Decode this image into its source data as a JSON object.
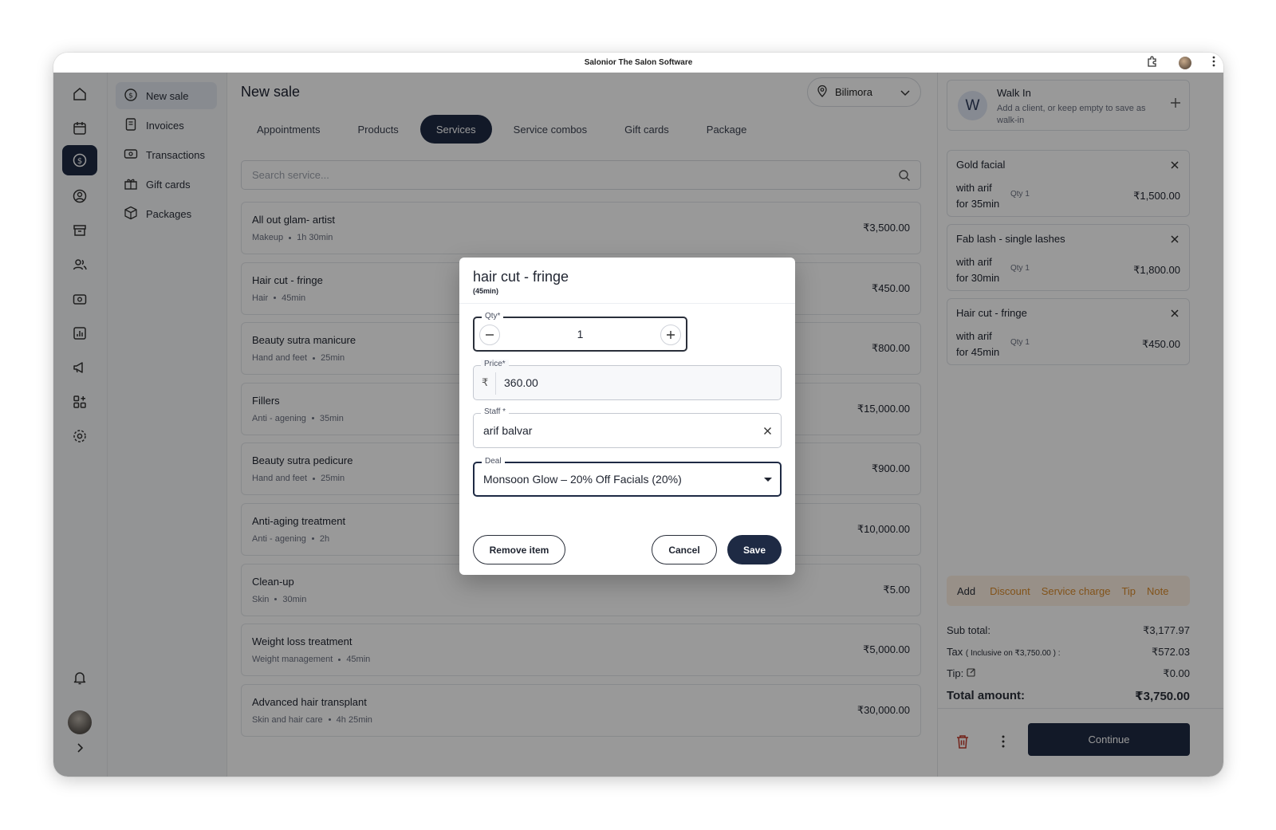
{
  "window": {
    "title": "Salonior The Salon Software"
  },
  "rail": {
    "icons": [
      "home-icon",
      "calendar-icon",
      "dollar-icon",
      "client-icon",
      "inventory-icon",
      "team-icon",
      "payments-icon",
      "reports-icon",
      "marketing-icon",
      "apps-icon",
      "settings-icon",
      "bell-icon",
      "avatar",
      "chevron-right-icon"
    ],
    "active": "dollar-icon"
  },
  "subnav": {
    "items": [
      {
        "label": "New sale",
        "icon": "dollar-plus-icon",
        "active": true
      },
      {
        "label": "Invoices",
        "icon": "invoice-icon",
        "active": false
      },
      {
        "label": "Transactions",
        "icon": "transaction-icon",
        "active": false
      },
      {
        "label": "Gift cards",
        "icon": "gift-icon",
        "active": false
      },
      {
        "label": "Packages",
        "icon": "package-icon",
        "active": false
      }
    ]
  },
  "main": {
    "title": "New sale",
    "location": "Bilimora",
    "tabs": [
      {
        "label": "Appointments",
        "active": false
      },
      {
        "label": "Products",
        "active": false
      },
      {
        "label": "Services",
        "active": true
      },
      {
        "label": "Service combos",
        "active": false
      },
      {
        "label": "Gift cards",
        "active": false
      },
      {
        "label": "Package",
        "active": false
      }
    ],
    "search_placeholder": "Search service...",
    "services": [
      {
        "name": "All out glam- artist",
        "category": "Makeup",
        "duration": "1h 30min",
        "price": "₹3,500.00"
      },
      {
        "name": "Hair cut - fringe",
        "category": "Hair",
        "duration": "45min",
        "price": "₹450.00"
      },
      {
        "name": "Beauty sutra manicure",
        "category": "Hand and feet",
        "duration": "25min",
        "price": "₹800.00"
      },
      {
        "name": "Fillers",
        "category": "Anti - agening",
        "duration": "35min",
        "price": "₹15,000.00"
      },
      {
        "name": "Beauty sutra pedicure",
        "category": "Hand and feet",
        "duration": "25min",
        "price": "₹900.00"
      },
      {
        "name": "Anti-aging treatment",
        "category": "Anti - agening",
        "duration": "2h",
        "price": "₹10,000.00"
      },
      {
        "name": "Clean-up",
        "category": "Skin",
        "duration": "30min",
        "price": "₹5.00"
      },
      {
        "name": "Weight loss treatment",
        "category": "Weight management",
        "duration": "45min",
        "price": "₹5,000.00"
      },
      {
        "name": "Advanced hair transplant",
        "category": "Skin and hair care",
        "duration": "4h 25min",
        "price": "₹30,000.00"
      }
    ]
  },
  "cart": {
    "client": {
      "initial": "W",
      "name": "Walk In",
      "desc": "Add a client, or keep empty to save as walk-in"
    },
    "items": [
      {
        "name": "Gold facial",
        "with": "with arif",
        "for": "for 35min",
        "qty": "Qty 1",
        "price": "₹1,500.00"
      },
      {
        "name": "Fab lash - single lashes",
        "with": "with arif",
        "for": "for 30min",
        "qty": "Qty 1",
        "price": "₹1,800.00"
      },
      {
        "name": "Hair cut - fringe",
        "with": "with arif",
        "for": "for 45min",
        "qty": "Qty 1",
        "price": "₹450.00"
      }
    ],
    "actions": {
      "add": "Add",
      "discount": "Discount",
      "service_charge": "Service charge",
      "tip": "Tip",
      "note": "Note"
    },
    "totals": {
      "subtotal_label": "Sub total:",
      "subtotal": "₹3,177.97",
      "tax_label": "Tax",
      "tax_note": "( Inclusive on ₹3,750.00 ) :",
      "tax": "₹572.03",
      "tip_label": "Tip:",
      "tip": "₹0.00",
      "total_label": "Total amount:",
      "total": "₹3,750.00"
    },
    "continue_label": "Continue"
  },
  "modal": {
    "title": "hair cut - fringe",
    "subtitle": "(45min)",
    "qty_label": "Qty*",
    "qty_value": "1",
    "price_label": "Price*",
    "currency": "₹",
    "price_value": "360.00",
    "staff_label": "Staff *",
    "staff_value": "arif balvar",
    "deal_label": "Deal",
    "deal_value": "Monsoon Glow – 20% Off Facials (20%)",
    "remove_label": "Remove item",
    "cancel_label": "Cancel",
    "save_label": "Save"
  },
  "colors": {
    "primary": "#1e2a44",
    "accent": "#d98a2b",
    "danger": "#c0392b"
  }
}
